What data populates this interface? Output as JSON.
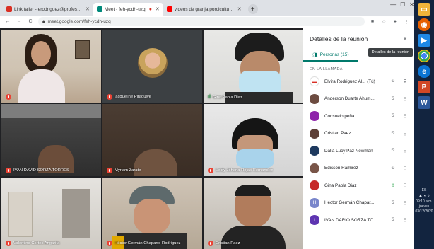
{
  "browser": {
    "tabs": [
      {
        "title": "Link taller - erodriguez@profesor...",
        "fav_color": "#d93025"
      },
      {
        "title": "Meet - feh-ycdh-uzq",
        "fav_color": "#00897b"
      },
      {
        "title": "videos de granja porcicultura - Yo...",
        "fav_color": "#ff0000"
      }
    ],
    "url": "meet.google.com/feh-ycdh-uzq"
  },
  "grid": {
    "tiles": [
      {
        "name": "",
        "muted": true,
        "kind": "camera-woman-office"
      },
      {
        "name": "jacqueline Piraquive",
        "muted": true,
        "kind": "avatar"
      },
      {
        "name": "Gina Paola Diaz",
        "muted": false,
        "kind": "camera-masked-man"
      },
      {
        "name": "IVAN DAVID SORZA TORRES",
        "muted": true,
        "kind": "camera-dim"
      },
      {
        "name": "Myriam Zarate",
        "muted": true,
        "kind": "camera-dim"
      },
      {
        "name": "Leidy Johana Rojas Hernandez",
        "muted": true,
        "kind": "camera-masked-woman"
      },
      {
        "name": "Valentina Cortes Angarita",
        "muted": true,
        "kind": "camera-room"
      },
      {
        "name": "Héctor Germán Chaparro Rodriguez",
        "muted": true,
        "kind": "camera-man-cap"
      },
      {
        "name": "Cristian Paez",
        "muted": true,
        "kind": "camera-man-glasses"
      }
    ]
  },
  "panel": {
    "title": "Detalles de la reunión",
    "close": "×",
    "tab_people": "Personas (15)",
    "tab_chat": "Chat",
    "tooltip": "Detalles de la reunión",
    "section": "EN LA LLAMADA",
    "people": [
      {
        "name": "Elvira Rodriguez Al...  (Tú)",
        "avatar_color": "#ffffff",
        "initial": "",
        "speaking": false,
        "self": true
      },
      {
        "name": "Anderson Duarte Ahum...",
        "avatar_color": "#6d4c41",
        "initial": "",
        "speaking": false,
        "self": false
      },
      {
        "name": "Consuelo peña",
        "avatar_color": "#8e24aa",
        "initial": "",
        "speaking": false,
        "self": false
      },
      {
        "name": "Cristian Paez",
        "avatar_color": "#5d4037",
        "initial": "",
        "speaking": false,
        "self": false
      },
      {
        "name": "Dalia Lucy Paz Newman",
        "avatar_color": "#1e3a5f",
        "initial": "",
        "speaking": false,
        "self": false
      },
      {
        "name": "Edisson Ramirez",
        "avatar_color": "#795548",
        "initial": "",
        "speaking": false,
        "self": false
      },
      {
        "name": "Gina Paola Diaz",
        "avatar_color": "#c62828",
        "initial": "",
        "speaking": true,
        "self": false
      },
      {
        "name": "Héctor Germán Chapar...",
        "avatar_color": "#7986cb",
        "initial": "H",
        "speaking": false,
        "self": false
      },
      {
        "name": "IVAN DARIO SORZA TO...",
        "avatar_color": "#5e35b1",
        "initial": "I",
        "speaking": false,
        "self": false
      }
    ]
  },
  "tray": {
    "lang": "ES",
    "time": "09:10 a.m.",
    "day": "jueves",
    "date": "03/12/2020"
  }
}
